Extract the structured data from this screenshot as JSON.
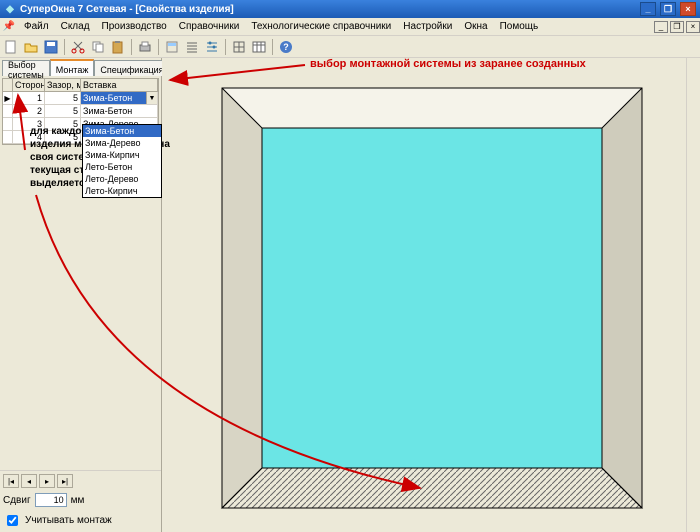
{
  "window": {
    "title": "СуперОкна 7 Сетевая - [Свойства изделия]"
  },
  "menu": {
    "items": [
      "Файл",
      "Склад",
      "Производство",
      "Справочники",
      "Технологические справочники",
      "Настройки",
      "Окна",
      "Помощь"
    ]
  },
  "tabs": {
    "t0": "Выбор системы",
    "t1": "Монтаж",
    "t2": "Спецификация"
  },
  "grid": {
    "headers": {
      "h1": "",
      "h2": "Сторона",
      "h3": "Зазор, мм",
      "h4": "Вставка"
    },
    "rows": [
      {
        "side": "1",
        "gap": "5",
        "insert": "Зима-Бетон",
        "ptr": "▶"
      },
      {
        "side": "2",
        "gap": "5",
        "insert": "Зима-Бетон",
        "ptr": ""
      },
      {
        "side": "3",
        "gap": "5",
        "insert": "Зима-Дерево",
        "ptr": ""
      },
      {
        "side": "4",
        "gap": "5",
        "insert": "Зима-Кирпич",
        "ptr": ""
      }
    ]
  },
  "dropdown": {
    "options": [
      "Зима-Бетон",
      "Зима-Дерево",
      "Зима-Кирпич",
      "Лето-Бетон",
      "Лето-Дерево",
      "Лето-Кирпич"
    ],
    "selected": "Зима-Бетон"
  },
  "footer": {
    "shift_label": "Сдвиг",
    "shift_value": "10",
    "shift_unit": "мм",
    "chk_label": "Учитывать монтаж"
  },
  "annotations": {
    "a1": "выбор монтажной системы из заранее созданных",
    "a2": "для каждой стороны изделия может быть задана своя система монтажа; текущая сторона выделяется штриховкой"
  }
}
